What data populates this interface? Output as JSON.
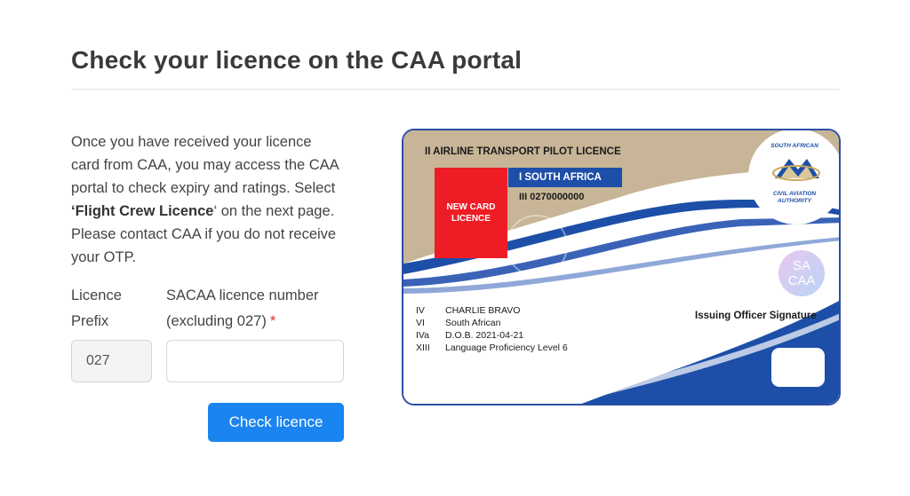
{
  "page": {
    "title": "Check your licence on the CAA portal",
    "intro_text_1": "Once you have received your licence card from CAA, you may access the CAA portal to check expiry and ratings. Select ",
    "intro_bold": "‘Flight Crew Licence",
    "intro_text_2": "‘ on the next page. Please contact CAA if you do not receive your OTP."
  },
  "form": {
    "prefix_label": "Licence Prefix",
    "prefix_value": "027",
    "number_label": "SACAA licence number (excluding 027)",
    "required_marker": "*",
    "number_value": "",
    "submit_label": "Check licence"
  },
  "card": {
    "licence_type": "II AIRLINE TRANSPORT PILOT LICENCE",
    "country": "I SOUTH AFRICA",
    "licence_number": "III 0270000000",
    "photo_placeholder": "NEW CARD LICENCE",
    "logo_top": "SOUTH AFRICAN",
    "logo_bottom": "CIVIL AVIATION AUTHORITY",
    "hologram": "SA CAA",
    "signature_label": "Issuing Officer Signature",
    "details": [
      {
        "code": "IV",
        "value": "CHARLIE BRAVO"
      },
      {
        "code": "VI",
        "value": "South African"
      },
      {
        "code": "IVa",
        "value": "D.O.B. 2021-04-21"
      },
      {
        "code": "XIII",
        "value": "Language Proficiency Level 6"
      }
    ]
  },
  "colors": {
    "accent": "#1a84f0",
    "card_blue": "#1e4fa8",
    "card_gold": "#c2ae8b",
    "photo_red": "#ee1c24",
    "required": "#e0332f"
  }
}
